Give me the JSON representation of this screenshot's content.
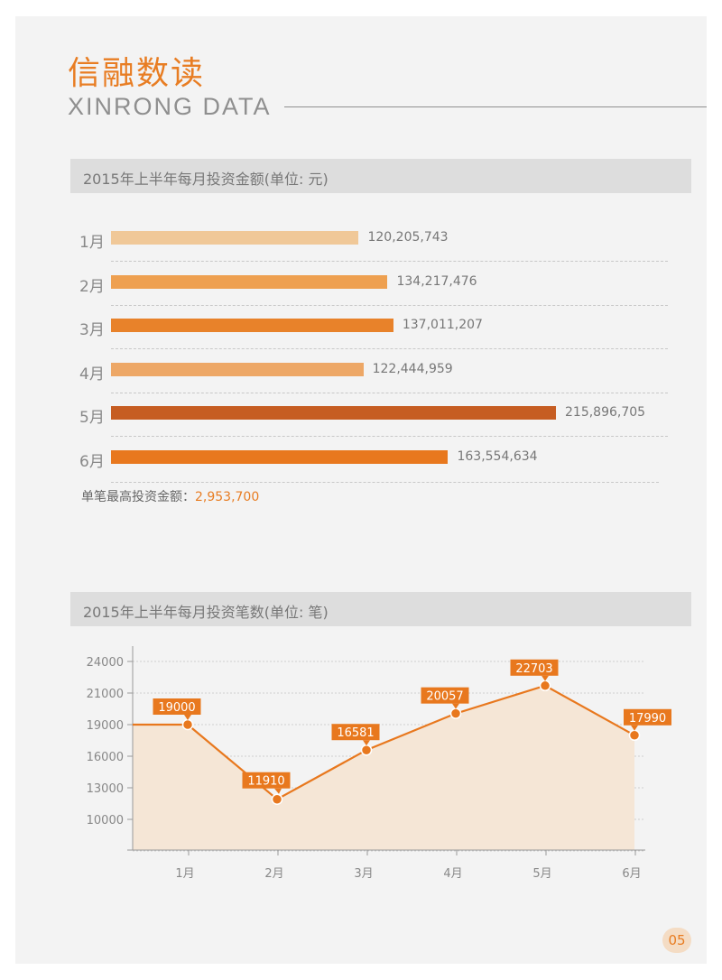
{
  "header": {
    "title": "信融数读",
    "subtitle": "XINRONG DATA"
  },
  "section1": {
    "title": "2015年上半年每月投资金额(单位: 元)"
  },
  "section2": {
    "title": "2015年上半年每月投资笔数(单位: 笔)"
  },
  "note": {
    "label": "单笔最高投资金额：",
    "value": "2,953,700"
  },
  "page_number": "05",
  "chart_data": [
    {
      "type": "bar",
      "orientation": "horizontal",
      "title": "2015年上半年每月投资金额(单位: 元)",
      "categories": [
        "1月",
        "2月",
        "3月",
        "4月",
        "5月",
        "6月"
      ],
      "values": [
        120205743,
        134217476,
        137011207,
        122444959,
        215896705,
        163554634
      ],
      "value_labels": [
        "120,205,743",
        "134,217,476",
        "137,011,207",
        "122,444,959",
        "215,896,705",
        "163,554,634"
      ],
      "colors": [
        "#f0c898",
        "#eea050",
        "#e8822a",
        "#eda766",
        "#c65d22",
        "#e8781e"
      ]
    },
    {
      "type": "line",
      "title": "2015年上半年每月投资笔数(单位: 笔)",
      "categories": [
        "1月",
        "2月",
        "3月",
        "4月",
        "5月",
        "6月"
      ],
      "values": [
        19000,
        11910,
        16581,
        20057,
        22703,
        17990
      ],
      "yticks": [
        10000,
        13000,
        16000,
        19000,
        21000,
        24000
      ],
      "line_color": "#e8781e",
      "fill_color": "#f5e6d6"
    }
  ]
}
